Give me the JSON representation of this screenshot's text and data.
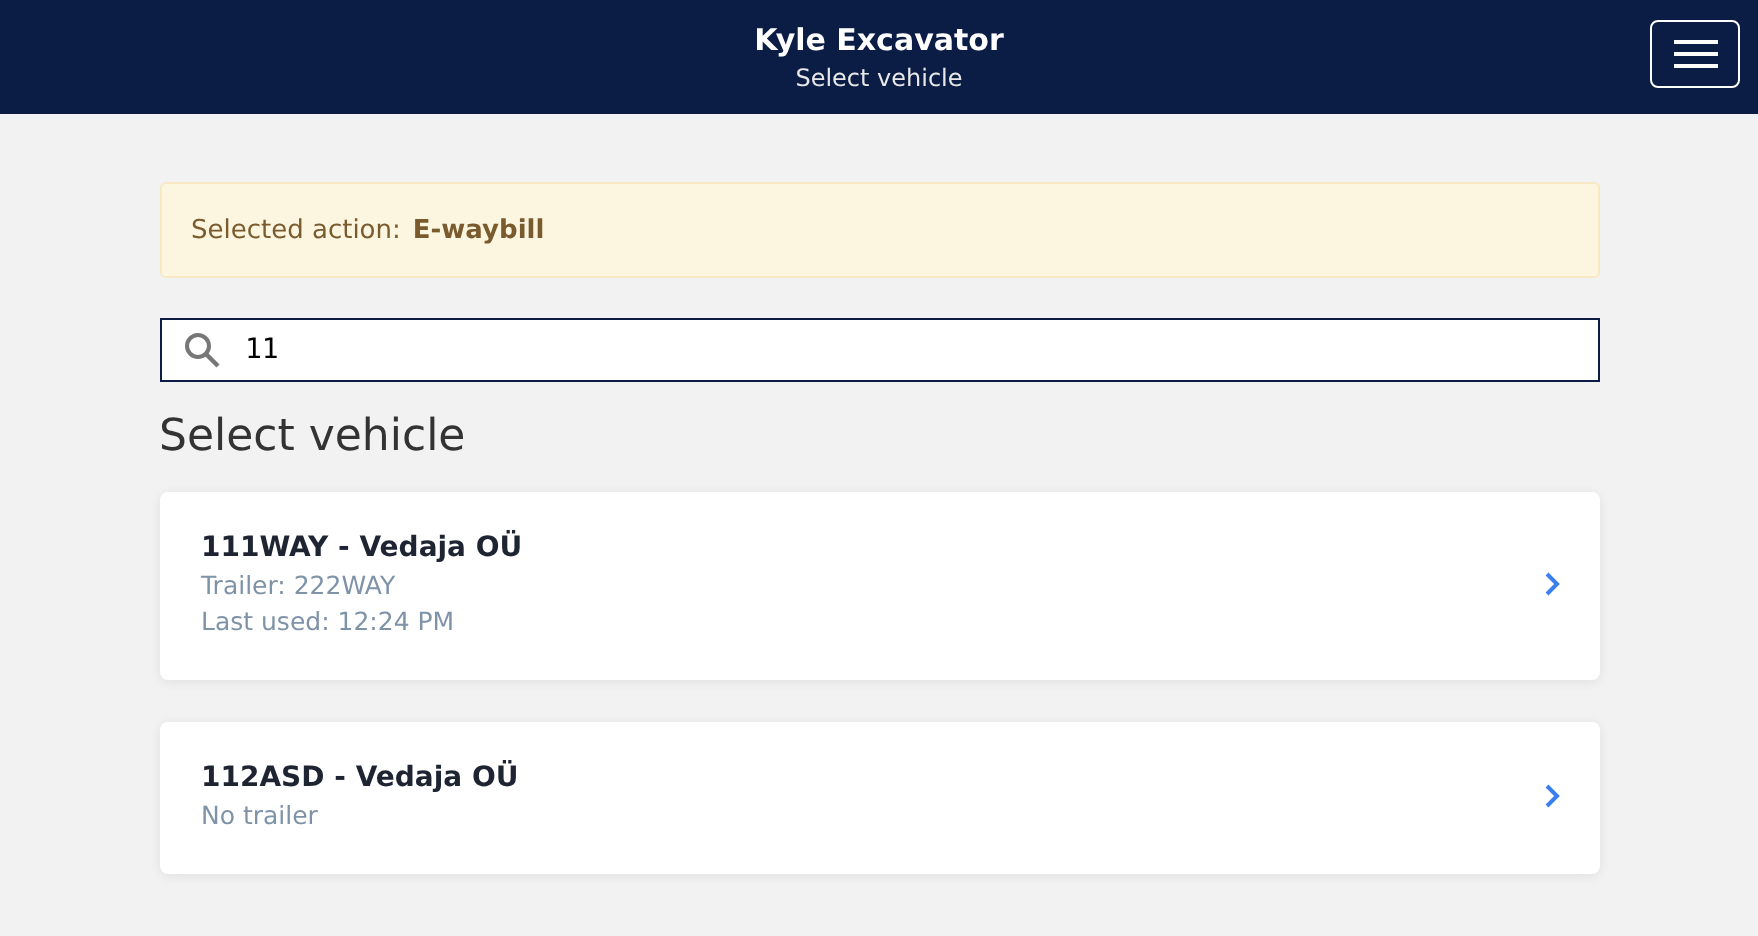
{
  "header": {
    "title": "Kyle Excavator",
    "subtitle": "Select vehicle"
  },
  "alert": {
    "label": "Selected action:",
    "value": "E-waybill"
  },
  "search": {
    "value": "11"
  },
  "heading": "Select vehicle",
  "vehicles": [
    {
      "name": "111WAY - Vedaja OÜ",
      "details": [
        "Trailer: 222WAY",
        "Last used: 12:24 PM"
      ]
    },
    {
      "name": "112ASD - Vedaja OÜ",
      "details": [
        "No trailer"
      ]
    }
  ]
}
